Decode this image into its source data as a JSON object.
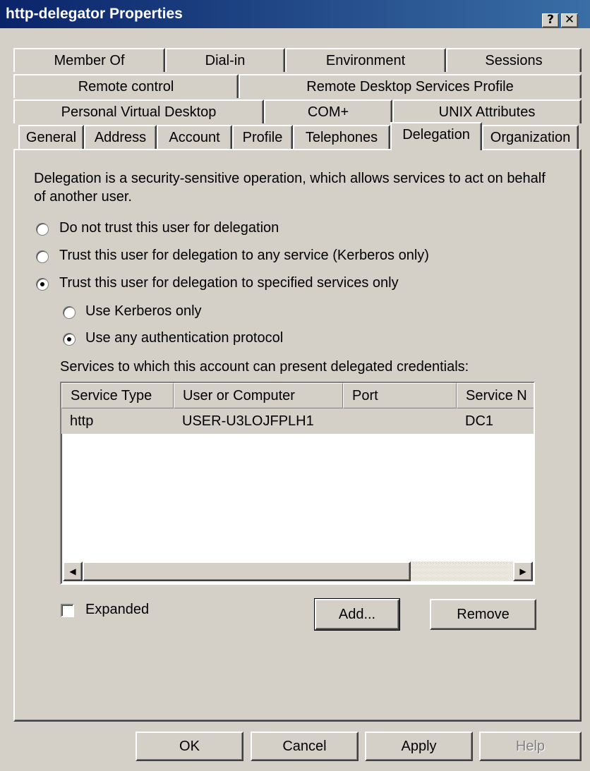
{
  "window": {
    "title": "http-delegator Properties",
    "help_glyph": "?",
    "close_glyph": "✕"
  },
  "tabs": {
    "row1": [
      "Member Of",
      "Dial-in",
      "Environment",
      "Sessions"
    ],
    "row2": [
      "Remote control",
      "Remote Desktop Services Profile"
    ],
    "row3": [
      "Personal Virtual Desktop",
      "COM+",
      "UNIX Attributes"
    ],
    "row4": [
      "General",
      "Address",
      "Account",
      "Profile",
      "Telephones",
      "Delegation",
      "Organization"
    ],
    "active": "Delegation"
  },
  "delegation": {
    "description": "Delegation is a security-sensitive operation, which allows services to act on behalf of another user.",
    "options": [
      {
        "label": "Do not trust this user for delegation",
        "selected": false
      },
      {
        "label": "Trust this user for delegation to any service (Kerberos only)",
        "selected": false
      },
      {
        "label": "Trust this user for delegation to specified services only",
        "selected": true
      }
    ],
    "sub_options": [
      {
        "label": "Use Kerberos only",
        "selected": false
      },
      {
        "label": "Use any authentication protocol",
        "selected": true
      }
    ],
    "services_label": "Services to which this account can present delegated credentials:",
    "columns": [
      "Service Type",
      "User or Computer",
      "Port",
      "Service N"
    ],
    "rows": [
      {
        "service_type": "http",
        "user_or_computer": "USER-U3LOJFPLH1",
        "port": "",
        "service_name": "DC1"
      }
    ],
    "expanded_label": "Expanded",
    "expanded_checked": false,
    "add_label": "Add...",
    "remove_label": "Remove"
  },
  "footer": {
    "ok": "OK",
    "cancel": "Cancel",
    "apply": "Apply",
    "help": "Help"
  },
  "icons": {
    "scroll_left": "◀",
    "scroll_right": "▶"
  }
}
